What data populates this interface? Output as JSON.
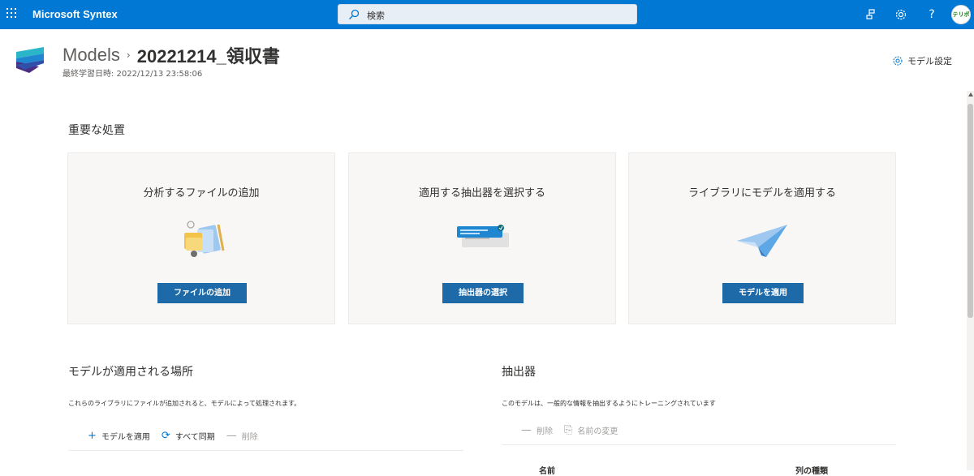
{
  "suite": {
    "app_name": "Microsoft Syntex",
    "search_placeholder": "検索",
    "avatar_text": "テリポ"
  },
  "header": {
    "breadcrumb_root": "Models",
    "breadcrumb_current": "20221214_領収書",
    "last_trained": "最終学習日時: 2022/12/13 23:58:06",
    "settings_label": "モデル設定"
  },
  "important_actions": {
    "title": "重要な処置",
    "cards": [
      {
        "title": "分析するファイルの追加",
        "button": "ファイルの追加",
        "icon": "files-illustration"
      },
      {
        "title": "適用する抽出器を選択する",
        "button": "抽出器の選択",
        "icon": "extractor-illustration"
      },
      {
        "title": "ライブラリにモデルを適用する",
        "button": "モデルを適用",
        "icon": "paper-plane-illustration"
      }
    ]
  },
  "applied_locations": {
    "title": "モデルが適用される場所",
    "description": "これらのライブラリにファイルが追加されると、モデルによって処理されます。",
    "commands": [
      "モデルを適用",
      "すべて同期",
      "削除"
    ]
  },
  "extractors": {
    "title": "抽出器",
    "description": "このモデルは、一般的な情報を抽出するようにトレーニングされています",
    "commands": [
      "削除",
      "名前の変更"
    ],
    "columns": [
      "名前",
      "列の種類"
    ]
  },
  "colors": {
    "suite_bar": "#0078d4",
    "primary_button": "#1e6aa8",
    "card_background": "#f8f7f6"
  }
}
